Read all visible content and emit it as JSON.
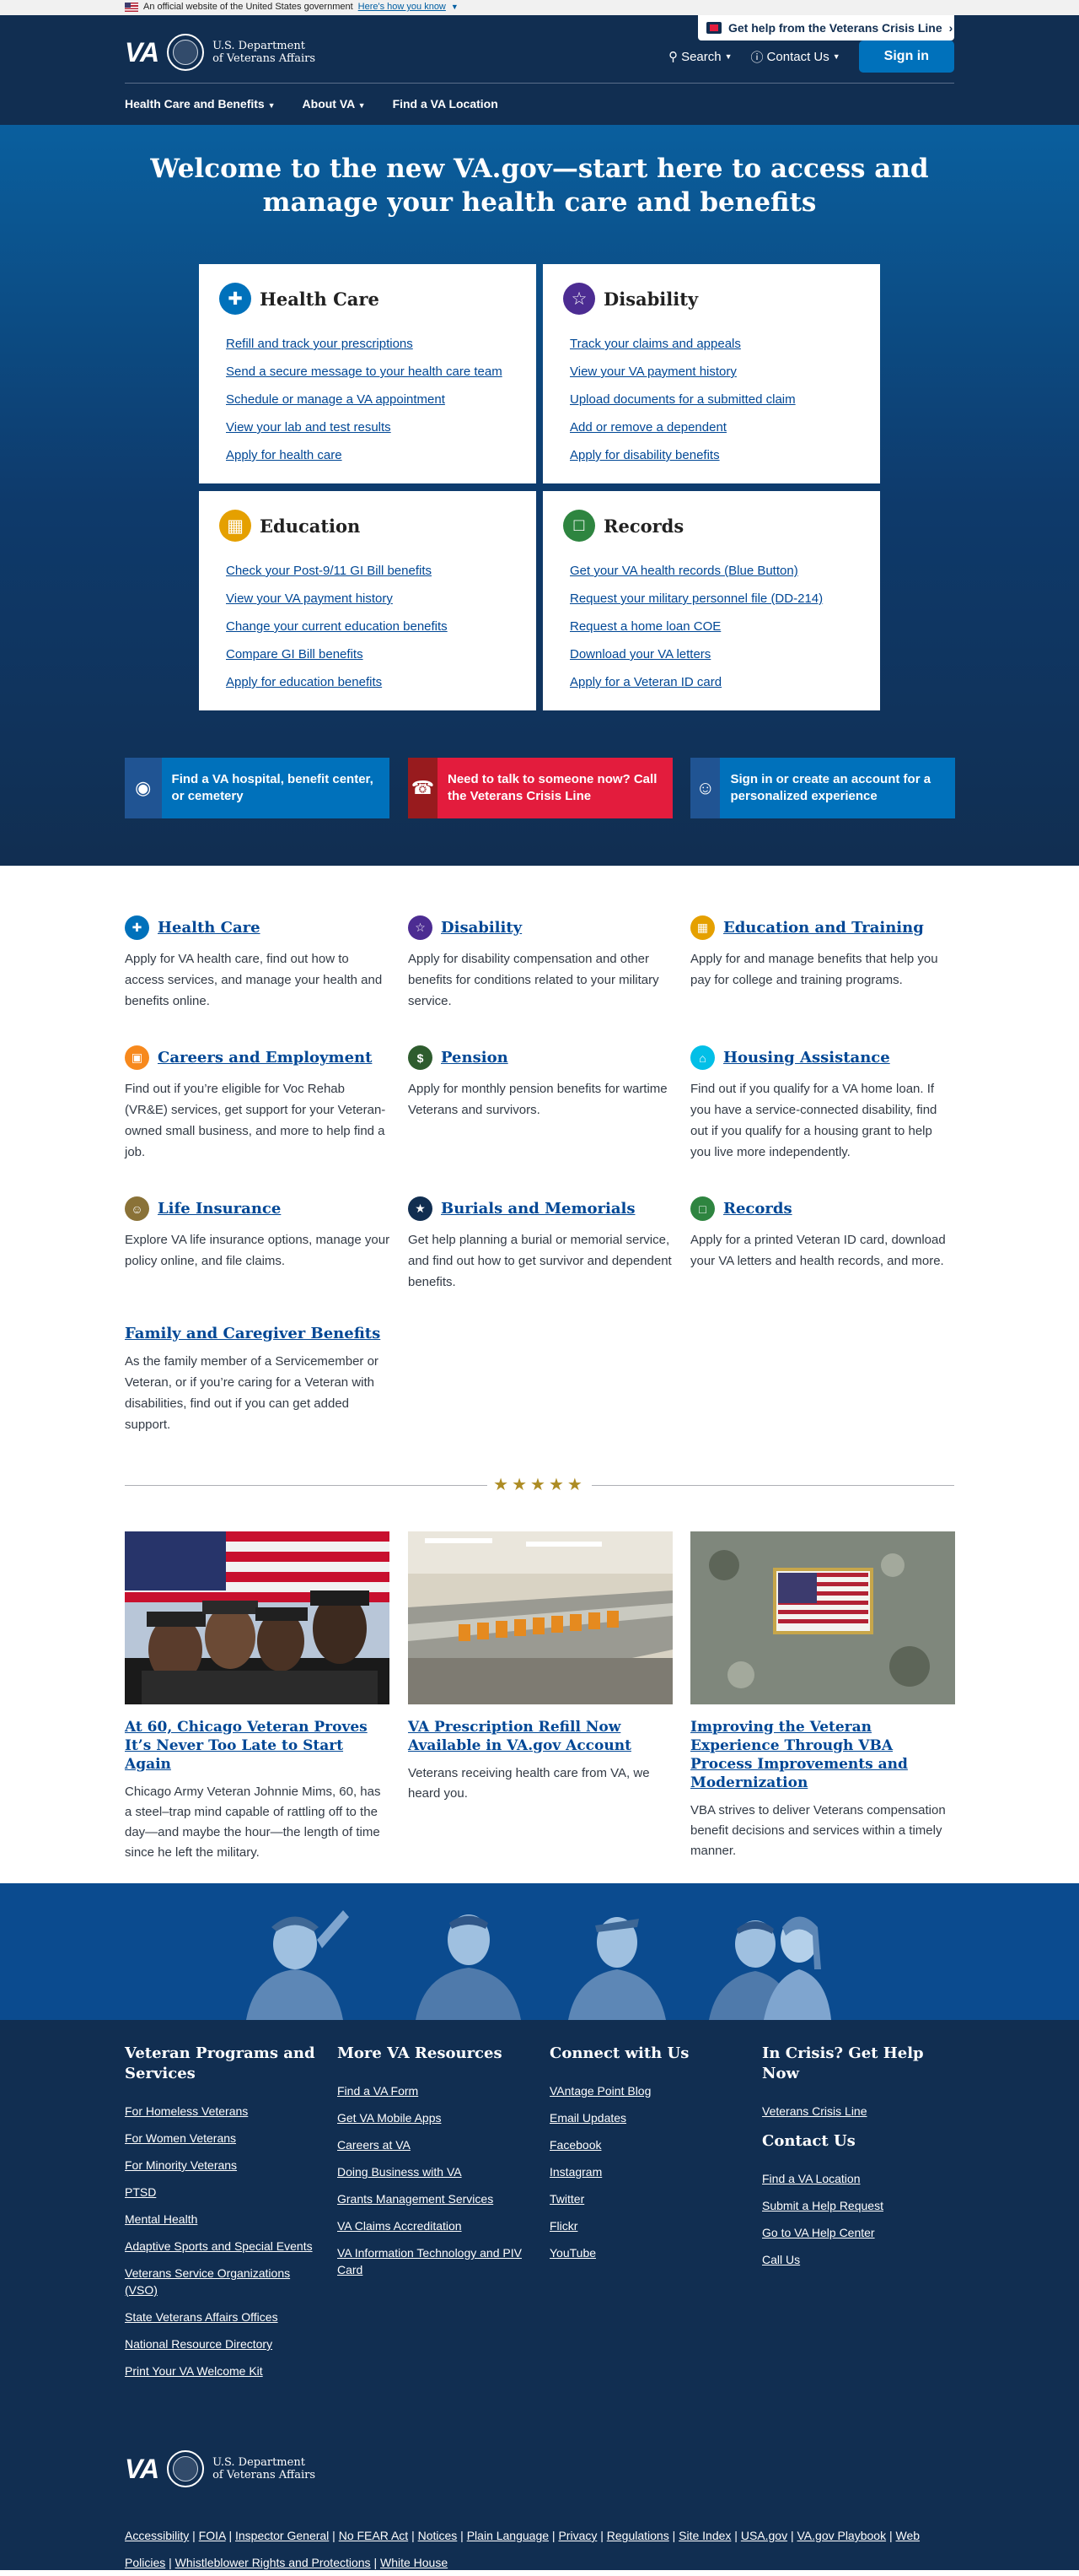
{
  "official_banner": {
    "text": "An official website of the United States government",
    "link": "Here's how you know"
  },
  "header": {
    "crisis_line": "Get help from the Veterans Crisis Line",
    "logo_va": "VA",
    "logo_dept_line1": "U.S. Department",
    "logo_dept_line2": "of Veterans Affairs",
    "search": "Search",
    "contact": "Contact Us",
    "sign_in": "Sign in",
    "nav": [
      "Health Care and Benefits",
      "About VA",
      "Find a VA Location"
    ]
  },
  "hero": {
    "title": "Welcome to the new VA.gov—start here to access and manage your health care and benefits",
    "cards": [
      {
        "title": "Health Care",
        "icon": "medical-kit-icon",
        "color": "#0071bb",
        "links": [
          "Refill and track your prescriptions",
          "Send a secure message to your health care team",
          "Schedule or manage a VA appointment",
          "View your lab and test results",
          "Apply for health care"
        ]
      },
      {
        "title": "Disability",
        "icon": "handshake-icon",
        "color": "#4c2c92",
        "links": [
          "Track your claims and appeals",
          "View your VA payment history",
          "Upload documents for a submitted claim",
          "Add or remove a dependent",
          "Apply for disability benefits"
        ]
      },
      {
        "title": "Education",
        "icon": "book-icon",
        "color": "#e5a000",
        "links": [
          "Check your Post-9/11 GI Bill benefits",
          "View your VA payment history",
          "Change your current education benefits",
          "Compare GI Bill benefits",
          "Apply for education benefits"
        ]
      },
      {
        "title": "Records",
        "icon": "id-card-icon",
        "color": "#2e8540",
        "links": [
          "Get your VA health records (Blue Button)",
          "Request your military personnel file (DD-214)",
          "Request a home loan COE",
          "Download your VA letters",
          "Apply for a Veteran ID card"
        ]
      }
    ],
    "ctas": [
      {
        "text": "Find a VA hospital, benefit center, or cemetery",
        "icon": "map-marker-icon",
        "color": "#0071bb",
        "icon_bg": "#205493"
      },
      {
        "text": "Need to talk to someone now? Call the Veterans Crisis Line",
        "icon": "crisis-line-icon",
        "color": "#e31c3d",
        "icon_bg": "#981b1e"
      },
      {
        "text": "Sign in or create an account for a personalized experience",
        "icon": "user-circle-icon",
        "color": "#0071bb",
        "icon_bg": "#205493"
      }
    ]
  },
  "hubs": [
    {
      "title": "Health Care",
      "icon": "medical-kit-icon",
      "color": "#0071bb",
      "text": "Apply for VA health care, find out how to access services, and manage your health and benefits online."
    },
    {
      "title": "Disability",
      "icon": "handshake-icon",
      "color": "#4c2c92",
      "text": "Apply for disability compensation and other benefits for conditions related to your military service."
    },
    {
      "title": "Education and Training",
      "icon": "book-icon",
      "color": "#e5a000",
      "text": "Apply for and manage benefits that help you pay for college and training programs."
    },
    {
      "title": "Careers and Employment",
      "icon": "briefcase-icon",
      "color": "#f7891d",
      "text": "Find out if you’re eligible for Voc Rehab (VR&E) services, get support for your Veteran-owned small business, and more to help find a job."
    },
    {
      "title": "Pension",
      "icon": "dollar-icon",
      "color": "#2e5c2e",
      "text": "Apply for monthly pension benefits for wartime Veterans and survivors."
    },
    {
      "title": "Housing Assistance",
      "icon": "home-icon",
      "color": "#02bfe7",
      "text": "Find out if you qualify for a VA home loan. If you have a service-connected disability, find out if you qualify for a housing grant to help you live more independently."
    },
    {
      "title": "Life Insurance",
      "icon": "people-icon",
      "color": "#8a7237",
      "text": "Explore VA life insurance options, manage your policy online, and file claims."
    },
    {
      "title": "Burials and Memorials",
      "icon": "star-icon",
      "color": "#112e51",
      "text": "Get help planning a burial or memorial service, and find out how to get survivor and dependent benefits."
    },
    {
      "title": "Records",
      "icon": "id-card-icon",
      "color": "#2e8540",
      "text": "Apply for a printed Veteran ID card, download your VA letters and health records, and more."
    },
    {
      "title": "Family and Caregiver Benefits",
      "icon": "",
      "color": "",
      "text": "As the family member of a Servicemember or Veteran, or if you’re caring for a Veteran with disabilities, find out if you can get added support."
    }
  ],
  "divider_stars": "★★★★★",
  "news": [
    {
      "title": "At 60, Chicago Veteran Proves It’s Never Too Late to Start Again",
      "text": "Chicago Army Veteran Johnnie Mims, 60, has a steel–trap mind capable of rattling off to the day—and maybe the hour—the length of time since he left the military.",
      "image": "veterans-with-flag-photo"
    },
    {
      "title": "VA Prescription Refill Now Available in VA.gov Account",
      "text": "Veterans receiving health care from VA, we heard you.",
      "image": "pharmacy-bottles-photo"
    },
    {
      "title": "Improving the Veteran Experience Through VBA Process Improvements and Modernization",
      "text": "VBA strives to deliver Veterans compensation benefit decisions and services within a timely manner.",
      "image": "flag-patch-photo"
    }
  ],
  "footer": {
    "columns": [
      {
        "title": "Veteran Programs and Services",
        "links": [
          "For Homeless Veterans",
          "For Women Veterans",
          "For Minority Veterans",
          "PTSD",
          "Mental Health",
          "Adaptive Sports and Special Events",
          "Veterans Service Organizations (VSO)",
          "State Veterans Affairs Offices",
          "National Resource Directory",
          "Print Your VA Welcome Kit"
        ]
      },
      {
        "title": "More VA Resources",
        "links": [
          "Find a VA Form",
          "Get VA Mobile Apps",
          "Careers at VA",
          "Doing Business with VA",
          "Grants Management Services",
          "VA Claims Accreditation",
          "VA Information Technology and PIV Card"
        ]
      },
      {
        "title": "Connect with Us",
        "links": [
          "VAntage Point Blog",
          "Email Updates",
          "Facebook",
          "Instagram",
          "Twitter",
          "Flickr",
          "YouTube"
        ]
      },
      {
        "title": "In Crisis? Get Help Now",
        "links": [
          "Veterans Crisis Line"
        ],
        "title2": "Contact Us",
        "links2": [
          "Find a VA Location",
          "Submit a Help Request",
          "Go to VA Help Center",
          "Call Us"
        ]
      }
    ],
    "legal": [
      "Accessibility",
      "FOIA",
      "Inspector General",
      "No FEAR Act",
      "Notices",
      "Plain Language",
      "Privacy",
      "Regulations",
      "Site Index",
      "USA.gov",
      "VA.gov Playbook",
      "Web Policies",
      "Whistleblower Rights and Protections",
      "White House"
    ]
  }
}
